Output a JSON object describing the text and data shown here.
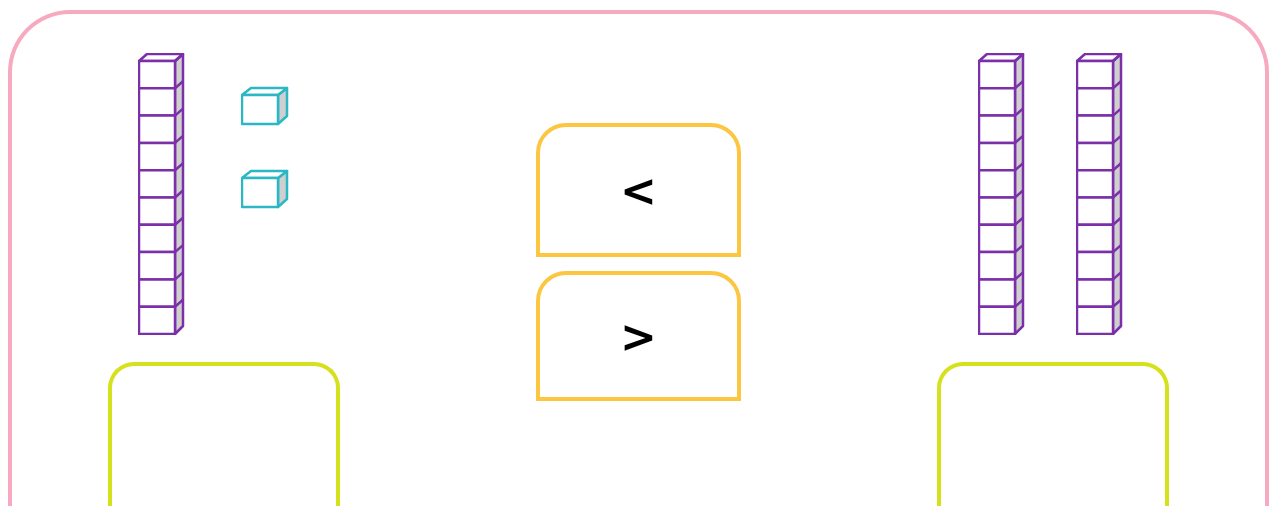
{
  "left_group": {
    "blocks": [
      {
        "kind": "ten"
      },
      {
        "kind": "one"
      },
      {
        "kind": "one"
      }
    ]
  },
  "symbol_choices": [
    {
      "label": "<"
    },
    {
      "label": ">"
    }
  ],
  "right_group": {
    "blocks": [
      {
        "kind": "ten"
      },
      {
        "kind": "ten"
      }
    ]
  }
}
